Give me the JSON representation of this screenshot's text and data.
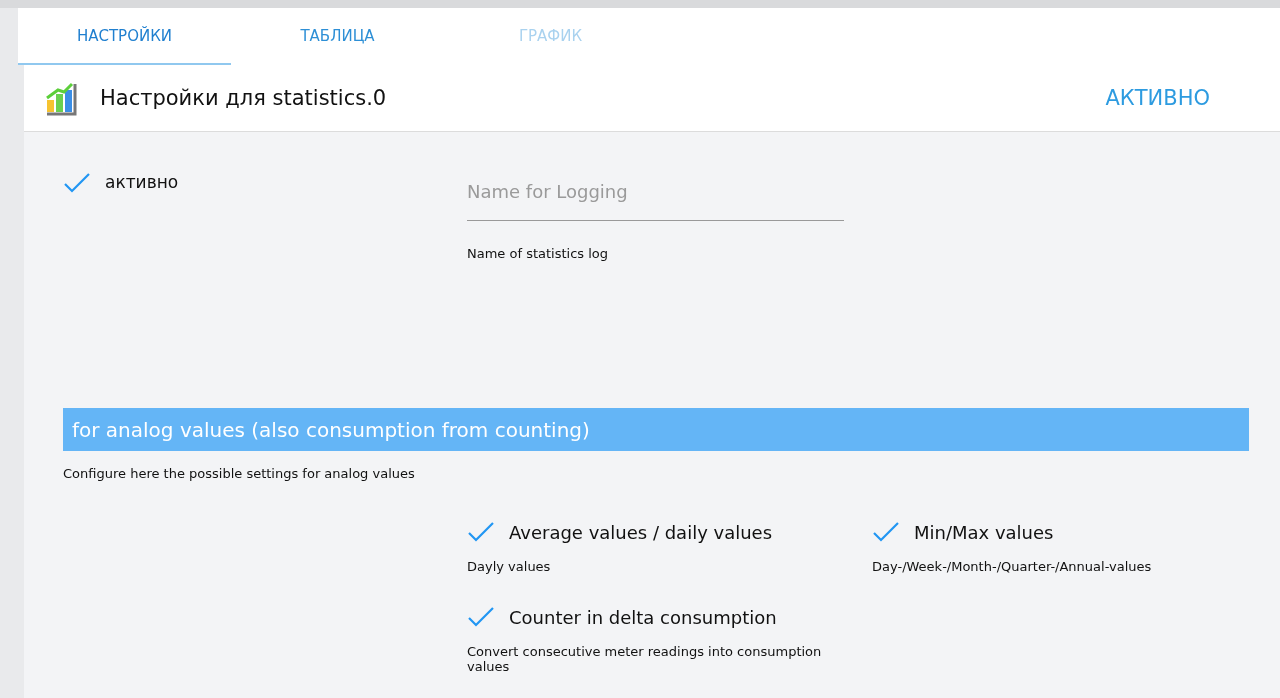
{
  "tabs": [
    {
      "label": "НАСТРОЙКИ",
      "selected": true,
      "disabled": false
    },
    {
      "label": "ТАБЛИЦА",
      "selected": false,
      "disabled": false
    },
    {
      "label": "ГРАФИК",
      "selected": false,
      "disabled": true
    }
  ],
  "header": {
    "title": "Настройки для statistics.0",
    "status": "АКТИВНО"
  },
  "enabled": {
    "label": "активно",
    "checked": true
  },
  "log_name": {
    "placeholder": "Name for Logging",
    "help": "Name of statistics log"
  },
  "section": {
    "title": "for analog values (also consumption from counting)",
    "description": "Configure here the possible settings for analog values"
  },
  "options": [
    {
      "label": "Average values / daily values",
      "checked": true,
      "help": "Dayly values"
    },
    {
      "label": "Min/Max values",
      "checked": true,
      "help": "Day-/Week-/Month-/Quarter-/Annual-values"
    },
    {
      "label": "Counter in delta consumption",
      "checked": true,
      "help": "Convert consecutive meter readings into consumption values"
    }
  ]
}
